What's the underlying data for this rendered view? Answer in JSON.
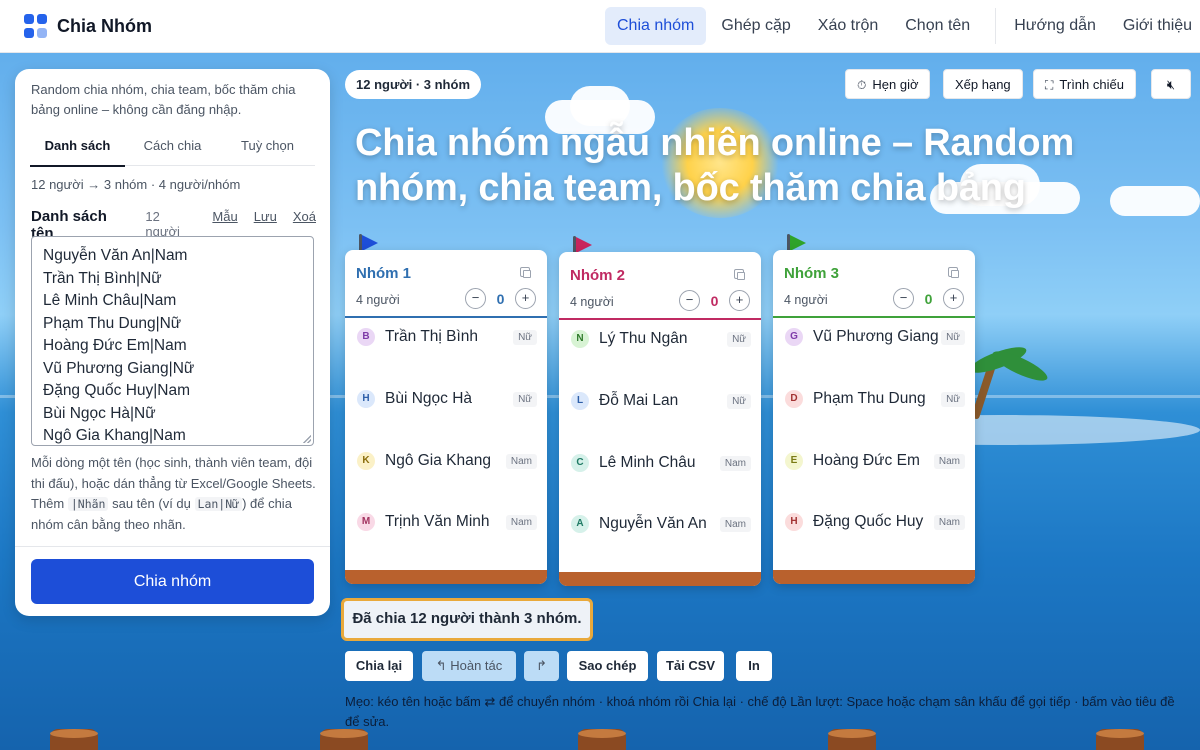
{
  "brand": {
    "name": "Chia Nhóm",
    "icon": "grid-logo-icon"
  },
  "nav": {
    "items": [
      {
        "label": "Chia nhóm",
        "active": true
      },
      {
        "label": "Ghép cặp",
        "active": false
      },
      {
        "label": "Xáo trộn",
        "active": false
      },
      {
        "label": "Chọn tên",
        "active": false
      }
    ],
    "secondary": [
      {
        "label": "Hướng dẫn"
      },
      {
        "label": "Giới thiệu"
      }
    ]
  },
  "panel": {
    "intro": "Random chia nhóm, chia team, bốc thăm chia bảng online – không cần đăng nhập.",
    "tabs": [
      "Danh sách",
      "Cách chia",
      "Tuỳ chọn"
    ],
    "active_tab": "Danh sách",
    "summary": "12 người → 3 nhóm · 4 người/nhóm",
    "list_title": "Danh sách tên",
    "list_count": "12 người",
    "links": {
      "sample": "Mẫu",
      "save": "Lưu",
      "clear": "Xoá"
    },
    "names": [
      "Nguyễn Văn An|Nam",
      "Trần Thị Bình|Nữ",
      "Lê Minh Châu|Nam",
      "Phạm Thu Dung|Nữ",
      "Hoàng Đức Em|Nam",
      "Vũ Phương Giang|Nữ",
      "Đặng Quốc Huy|Nam",
      "Bùi Ngọc Hà|Nữ",
      "Ngô Gia Khang|Nam"
    ],
    "help": {
      "part1": "Mỗi dòng một tên (học sinh, thành viên team, đội thi đấu), hoặc dán thẳng từ Excel/Google Sheets. Thêm",
      "code1": "|Nhãn",
      "part2": "sau tên (ví dụ",
      "code2": "Lan|Nữ",
      "part3": ") để chia nhóm cân bằng theo nhãn."
    },
    "submit": "Chia nhóm"
  },
  "stage": {
    "pill": "12 người · 3 nhóm",
    "tools": {
      "timer": "Hẹn giờ",
      "timer_icon": "clock-icon",
      "ranking": "Xếp hạng",
      "present": "Trình chiếu",
      "present_icon": "fullscreen-icon",
      "mute_icon": "mute-icon"
    },
    "headline": "Chia nhóm ngẫu nhiên online – Random nhóm, chia team, bốc thăm chia bảng"
  },
  "groups": [
    {
      "name": "Nhóm 1",
      "count": "4 người",
      "score": "0",
      "color": "#2f6fb0",
      "flag_color": "#1d4ed8",
      "members": [
        {
          "initial": "B",
          "name": "Trần Thị Bình",
          "tag": "Nữ",
          "bg": "#ead7f5",
          "fg": "#7e3aa8"
        },
        {
          "initial": "H",
          "name": "Bùi Ngọc Hà",
          "tag": "Nữ",
          "bg": "#dbe8fb",
          "fg": "#2d5ea8"
        },
        {
          "initial": "K",
          "name": "Ngô Gia Khang",
          "tag": "Nam",
          "bg": "#fbf1c7",
          "fg": "#8a6d0b"
        },
        {
          "initial": "M",
          "name": "Trịnh Văn Minh",
          "tag": "Nam",
          "bg": "#f9d9e6",
          "fg": "#a2325f"
        }
      ]
    },
    {
      "name": "Nhóm 2",
      "count": "4 người",
      "score": "0",
      "color": "#c02a62",
      "flag_color": "#c8245d",
      "members": [
        {
          "initial": "N",
          "name": "Lý Thu Ngân",
          "tag": "Nữ",
          "bg": "#d8f3d4",
          "fg": "#2f7a2a"
        },
        {
          "initial": "L",
          "name": "Đỗ Mai Lan",
          "tag": "Nữ",
          "bg": "#dbe8fb",
          "fg": "#2d5ea8"
        },
        {
          "initial": "C",
          "name": "Lê Minh Châu",
          "tag": "Nam",
          "bg": "#d6f1ea",
          "fg": "#1f7a64"
        },
        {
          "initial": "A",
          "name": "Nguyễn Văn An",
          "tag": "Nam",
          "bg": "#d6f1ea",
          "fg": "#1f7a64"
        }
      ]
    },
    {
      "name": "Nhóm 3",
      "count": "4 người",
      "score": "0",
      "color": "#3fa23a",
      "flag_color": "#2fa32a",
      "members": [
        {
          "initial": "G",
          "name": "Vũ Phương Giang",
          "tag": "Nữ",
          "bg": "#ead7f5",
          "fg": "#7e3aa8"
        },
        {
          "initial": "D",
          "name": "Phạm Thu Dung",
          "tag": "Nữ",
          "bg": "#fbdcdc",
          "fg": "#a23232"
        },
        {
          "initial": "E",
          "name": "Hoàng Đức Em",
          "tag": "Nam",
          "bg": "#f4f6cf",
          "fg": "#7a7a14"
        },
        {
          "initial": "H",
          "name": "Đặng Quốc Huy",
          "tag": "Nam",
          "bg": "#fbdcdc",
          "fg": "#a23232"
        }
      ]
    }
  ],
  "result": "Đã chia 12 người thành 3 nhóm.",
  "actions": [
    {
      "label": "Chia lại",
      "disabled": false
    },
    {
      "label": "↰ Hoàn tác",
      "disabled": true
    },
    {
      "label": "↱",
      "disabled": true
    },
    {
      "label": "Sao chép",
      "disabled": false
    },
    {
      "label": "Tải CSV",
      "disabled": false
    },
    {
      "label": "In",
      "disabled": false
    }
  ],
  "tip": "Mẹo: kéo tên hoặc bấm ⇄ để chuyển nhóm · khoá nhóm rồi Chia lại · chế độ Lần lượt: Space hoặc chạm sân khấu để gọi tiếp · bấm vào tiêu đề để sửa."
}
